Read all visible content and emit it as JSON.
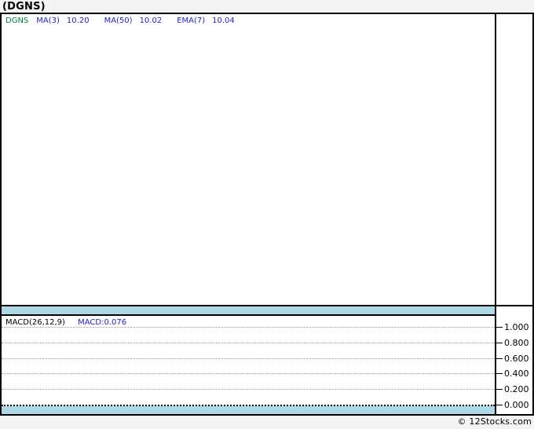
{
  "page": {
    "title": "(DGNS)",
    "footer_credit": "© 12Stocks.com",
    "background_color": "#f4f4f4"
  },
  "colors": {
    "ticker_green": "#008040",
    "indicator_blue": "#2222cc",
    "band_blue": "#ADD8E6",
    "gridline_gray": "#999999",
    "frame_black": "#000000"
  },
  "price_panel": {
    "ticker": "DGNS",
    "indicators": [
      {
        "label": "MA(3)",
        "value": "10.20"
      },
      {
        "label": "MA(50)",
        "value": "10.02"
      },
      {
        "label": "EMA(7)",
        "value": "10.04"
      }
    ]
  },
  "macd_panel": {
    "indicator_label": "MACD(26,12,9)",
    "value_label": "MACD:0.076",
    "axis_ticks": [
      "1.000",
      "0.800",
      "0.600",
      "0.400",
      "0.200",
      "0.000"
    ]
  },
  "chart_data": [
    {
      "type": "line",
      "title": "(DGNS)",
      "series": [
        {
          "name": "DGNS",
          "values": []
        },
        {
          "name": "MA(3)",
          "last_value": 10.2,
          "values": []
        },
        {
          "name": "MA(50)",
          "last_value": 10.02,
          "values": []
        },
        {
          "name": "EMA(7)",
          "last_value": 10.04,
          "values": []
        }
      ],
      "legend_position": "top-left",
      "grid": false,
      "note": "price panel is empty — no plotted points visible"
    },
    {
      "type": "line",
      "title": "MACD(26,12,9)",
      "series": [
        {
          "name": "MACD",
          "last_value": 0.076,
          "values": []
        }
      ],
      "ylim": [
        0.0,
        1.0
      ],
      "yticks": [
        1.0,
        0.8,
        0.6,
        0.4,
        0.2,
        0.0
      ],
      "grid": true,
      "legend_position": "top-left",
      "note": "horizontal dotted gridlines only — no plotted MACD line visible"
    }
  ]
}
